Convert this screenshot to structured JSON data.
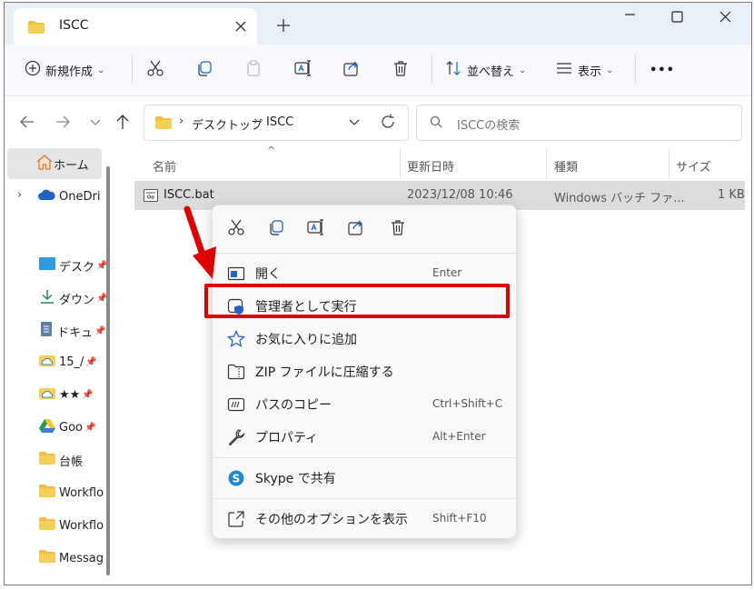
{
  "tab": {
    "title": "ISCC",
    "close": "✕",
    "new_tab": "+"
  },
  "window": {
    "minimize": "—",
    "maximize": "☐",
    "close": "✕"
  },
  "toolbar": {
    "new_label": "新規作成",
    "sort_label": "並べ替え",
    "view_label": "表示",
    "more_label": "•••"
  },
  "address": {
    "crumb_1": "デスクトップ",
    "crumb_2": "ISCC",
    "search_placeholder": "ISCCの検索"
  },
  "sidebar": {
    "items": [
      {
        "label": "ホーム"
      },
      {
        "label": "OneDrive"
      },
      {
        "label": "デスク"
      },
      {
        "label": "ダウン"
      },
      {
        "label": "ドキュ"
      },
      {
        "label": "15_/"
      },
      {
        "label": "★★"
      },
      {
        "label": "Goo"
      },
      {
        "label": "台帳"
      },
      {
        "label": "Workflo"
      },
      {
        "label": "Workflo"
      },
      {
        "label": "Messag"
      }
    ]
  },
  "columns": {
    "name": "名前",
    "date": "更新日時",
    "type": "種類",
    "size": "サイズ"
  },
  "file": {
    "name": "ISCC.bat",
    "date": "2023/12/08 10:46",
    "type": "Windows バッチ ファ...",
    "size": "1 KB"
  },
  "context_menu": {
    "open": {
      "label": "開く",
      "shortcut": "Enter"
    },
    "run_as_admin": {
      "label": "管理者として実行"
    },
    "favorite": {
      "label": "お気に入りに追加"
    },
    "zip": {
      "label": "ZIP ファイルに圧縮する"
    },
    "copy_path": {
      "label": "パスのコピー",
      "shortcut": "Ctrl+Shift+C"
    },
    "properties": {
      "label": "プロパティ",
      "shortcut": "Alt+Enter"
    },
    "skype": {
      "label": "Skype で共有"
    },
    "more_options": {
      "label": "その他のオプションを表示",
      "shortcut": "Shift+F10"
    }
  },
  "colors": {
    "highlight": "#e00000",
    "accent": "#1e63c8",
    "folder": "#f2bf3f"
  }
}
